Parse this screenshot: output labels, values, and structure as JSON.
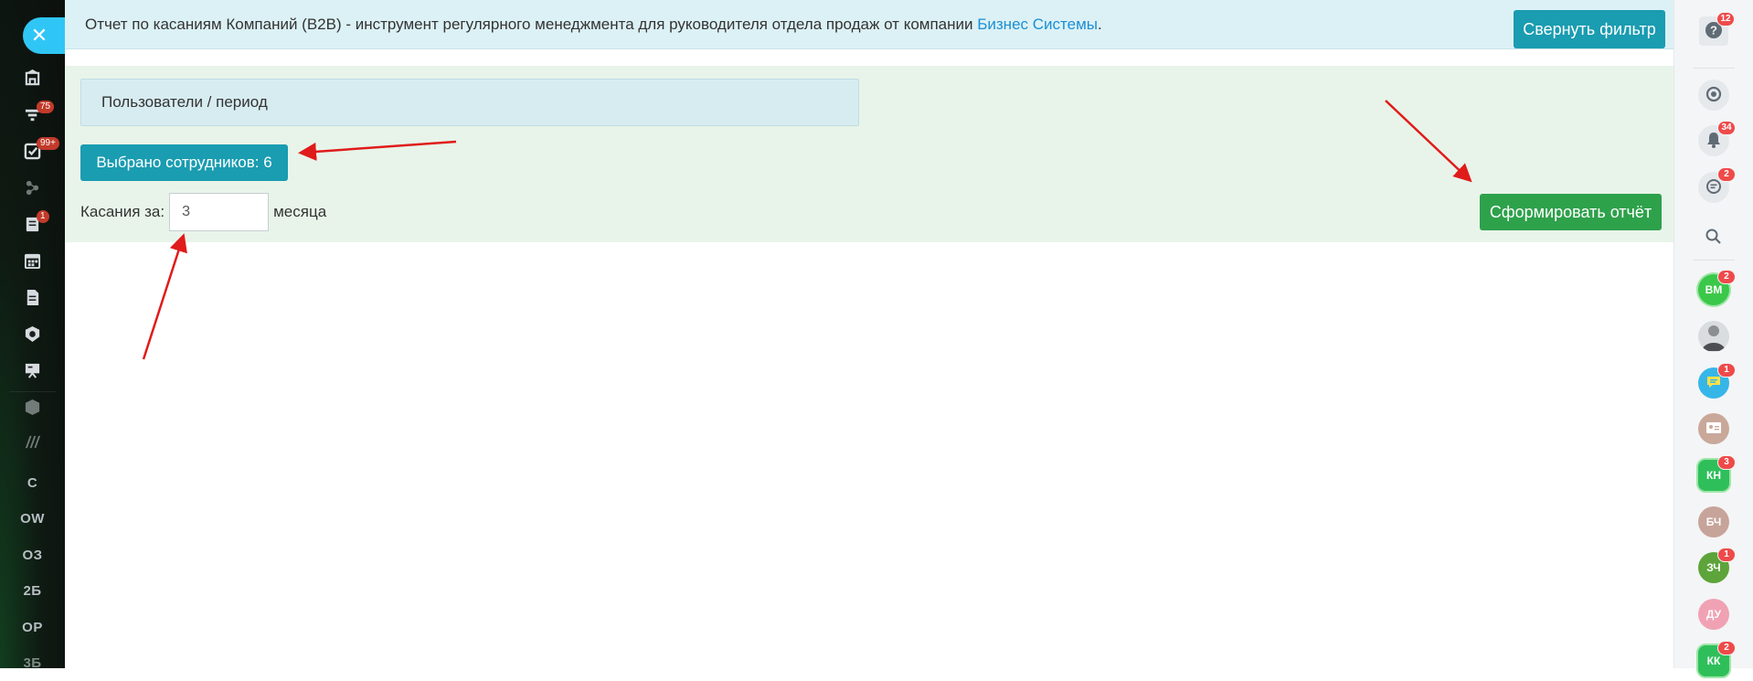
{
  "left_sidebar": {
    "close_icon": "close-icon",
    "items": [
      {
        "icon": "home-icon",
        "badge": ""
      },
      {
        "icon": "funnel-icon",
        "badge": "75"
      },
      {
        "icon": "tasks-icon",
        "badge": "99+"
      },
      {
        "icon": "network-icon",
        "badge": ""
      },
      {
        "icon": "notebook-icon",
        "badge": "1"
      },
      {
        "icon": "calendar-icon",
        "badge": ""
      },
      {
        "icon": "document-icon",
        "badge": ""
      },
      {
        "icon": "shield-icon",
        "badge": ""
      },
      {
        "icon": "presentation-icon",
        "badge": ""
      },
      {
        "icon": "box-icon",
        "badge": ""
      },
      {
        "icon": "stripes-icon",
        "badge": ""
      }
    ],
    "text_items": [
      "С",
      "OW",
      "ОЗ",
      "2Б",
      "ОР",
      "3Б"
    ]
  },
  "info_bar": {
    "text": "Отчет по касаниям Компаний (B2B) - инструмент регулярного менеджмента для руководителя отдела продаж от компании ",
    "link": "Бизнес Системы",
    "suffix": ".",
    "collapse_button": "Свернуть фильтр"
  },
  "filter": {
    "users_panel_title": "Пользователи / период",
    "selected_button": "Выбрано сотрудников: 6",
    "touches_label": "Касания за:",
    "months_value": "3",
    "months_label": "месяца",
    "generate_button": "Сформировать отчёт"
  },
  "right_sidebar": {
    "help_badge": "12",
    "notifications_badge": "34",
    "chat_badge": "2",
    "contacts": [
      {
        "initials": "ВМ",
        "color": "#3bc84a",
        "badge": "2",
        "shape": "circle"
      },
      {
        "initials": "",
        "color": "#b9bfc4",
        "badge": "",
        "shape": "photo"
      },
      {
        "initials": "",
        "color": "#36b6e8",
        "badge": "1",
        "shape": "chat"
      },
      {
        "initials": "",
        "color": "#c9a89a",
        "badge": "",
        "shape": "card"
      },
      {
        "initials": "КН",
        "color": "#2fbf5a",
        "badge": "3",
        "shape": "hex"
      },
      {
        "initials": "БЧ",
        "color": "#c7a49a",
        "badge": "",
        "shape": "circle"
      },
      {
        "initials": "ЗЧ",
        "color": "#5da43a",
        "badge": "1",
        "shape": "circle"
      },
      {
        "initials": "ДУ",
        "color": "#f0a2b4",
        "badge": "",
        "shape": "circle"
      },
      {
        "initials": "КК",
        "color": "#2fbf5a",
        "badge": "2",
        "shape": "hex"
      }
    ]
  },
  "colors": {
    "info_bar_bg": "#dcf1f5",
    "filter_bg": "#e8f4e9",
    "teal_button": "#1a9cb1",
    "green_button": "#2ea14b",
    "link": "#1a8fd6",
    "annotation_arrow": "#e01b1b"
  }
}
